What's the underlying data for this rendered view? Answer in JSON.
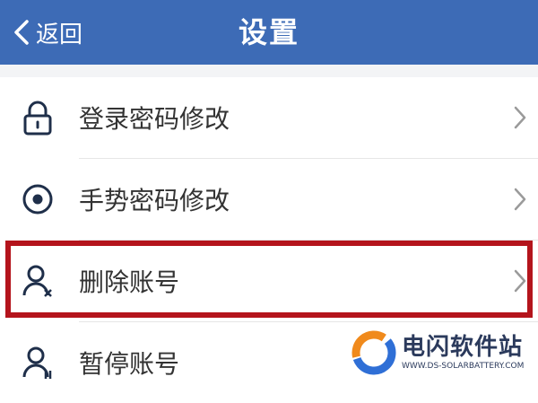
{
  "header": {
    "back_label": "返回",
    "title": "设置"
  },
  "settings": {
    "items": [
      {
        "label": "登录密码修改",
        "icon": "lock-icon"
      },
      {
        "label": "手势密码修改",
        "icon": "gesture-target-icon"
      },
      {
        "label": "删除账号",
        "icon": "user-delete-icon"
      },
      {
        "label": "暂停账号",
        "icon": "user-pause-icon"
      }
    ]
  },
  "watermark": {
    "name": "电闪软件站",
    "url": "WWW.DS-SOLARBATTERY.COM"
  },
  "colors": {
    "header_bg": "#3d6bb6",
    "highlight_border": "#b4141c",
    "icon": "#1f2f4a"
  }
}
